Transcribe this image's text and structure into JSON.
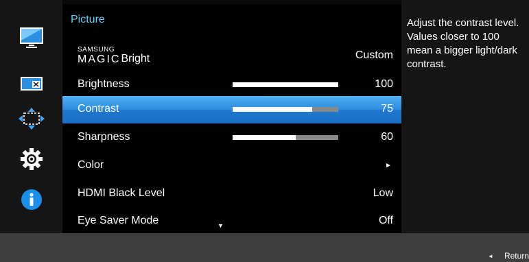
{
  "icons": {
    "picture": "monitor-icon",
    "onscreen_display": "screen-adjust-icon",
    "position": "move-arrows-icon",
    "system": "gear-icon",
    "information": "info-icon"
  },
  "menu": {
    "title": "Picture",
    "items": [
      {
        "label": "Bright",
        "value": "Custom"
      },
      {
        "label": "Brightness",
        "value": "100",
        "level": 1.0
      },
      {
        "label": "Contrast",
        "value": "75",
        "level": 0.75
      },
      {
        "label": "Sharpness",
        "value": "60",
        "level": 0.6
      },
      {
        "label": "Color",
        "value": "►"
      },
      {
        "label": "HDMI Black Level",
        "value": "Low"
      },
      {
        "label": "Eye Saver Mode",
        "value": "Off"
      }
    ],
    "magic_top": "SAMSUNG",
    "magic_bottom": "MAGIC",
    "scroll_indicator": "▼"
  },
  "help": {
    "text": "Adjust the contrast level. Values closer to 100 mean a bigger light/dark contrast."
  },
  "footer": {
    "return_arrow": "◄",
    "return_label": "Return"
  },
  "colors": {
    "accent": "#5fd0ff",
    "selection": "#2f8de0",
    "info_blue": "#1a8fe8"
  }
}
